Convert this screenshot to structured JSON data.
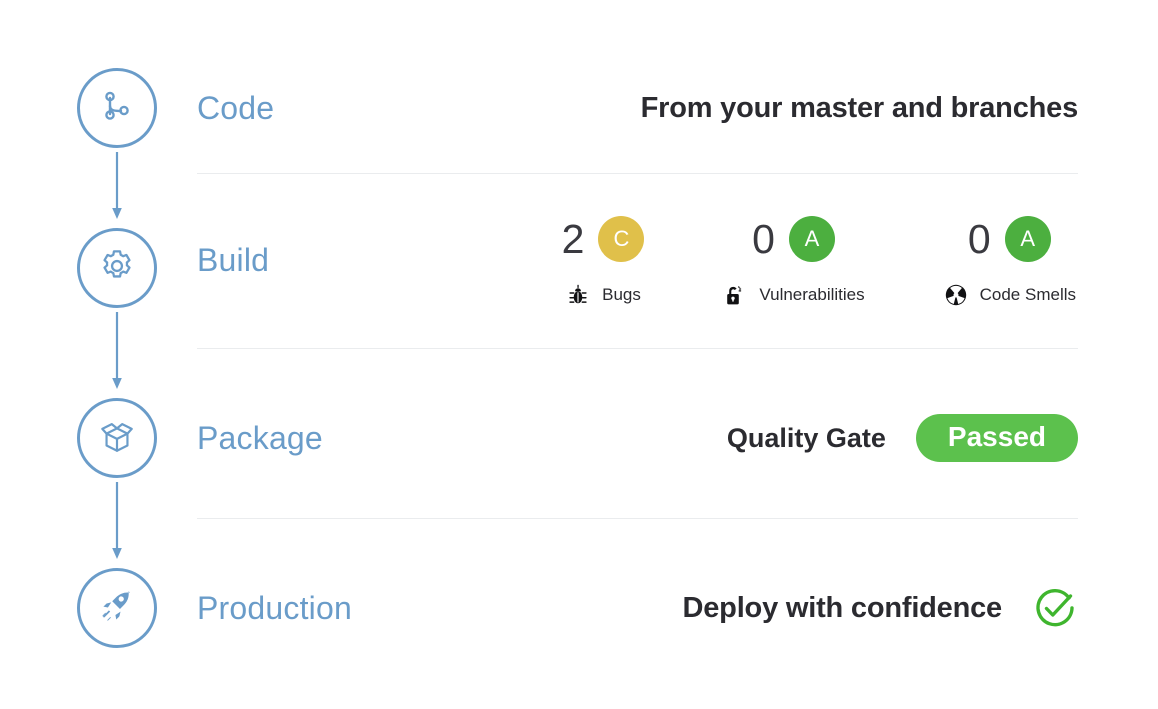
{
  "card": {
    "background": "#ffffff",
    "accent_blue": "#6a9cc9",
    "accent_green": "#5cc14d",
    "grade_gold": "#e0c04a",
    "grade_green": "#4caf3f",
    "divider": "#eaecee"
  },
  "stages": [
    {
      "id": "code",
      "label": "Code",
      "icon": "branch-icon"
    },
    {
      "id": "build",
      "label": "Build",
      "icon": "gear-icon"
    },
    {
      "id": "package",
      "label": "Package",
      "icon": "package-icon"
    },
    {
      "id": "production",
      "label": "Production",
      "icon": "rocket-icon"
    }
  ],
  "code_row": {
    "headline": "From your master and branches"
  },
  "build_row": {
    "metrics": [
      {
        "value": "2",
        "grade": "C",
        "grade_color": "#e0c04a",
        "name": "Bugs",
        "icon": "bug-icon"
      },
      {
        "value": "0",
        "grade": "A",
        "grade_color": "#4caf3f",
        "name": "Vulnerabilities",
        "icon": "open-padlock-icon"
      },
      {
        "value": "0",
        "grade": "A",
        "grade_color": "#4caf3f",
        "name": "Code Smells",
        "icon": "radiation-icon"
      }
    ]
  },
  "package_row": {
    "label": "Quality Gate",
    "status": "Passed",
    "status_color": "#5cc14d"
  },
  "production_row": {
    "headline": "Deploy with confidence",
    "icon": "check-circle-icon",
    "icon_color": "#3fb52e"
  }
}
